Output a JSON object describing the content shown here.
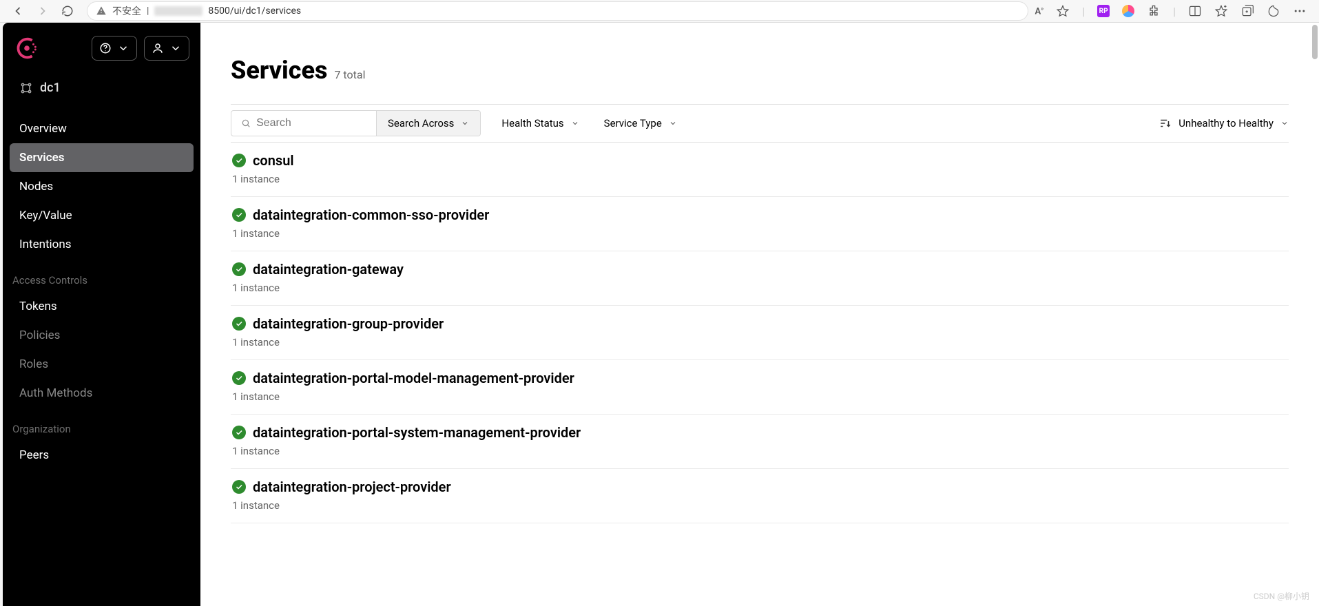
{
  "browser": {
    "not_secure_label": "不安全",
    "url_suffix": "8500/ui/dc1/services"
  },
  "sidebar": {
    "datacenter": "dc1",
    "main_nav": [
      {
        "label": "Overview"
      },
      {
        "label": "Services"
      },
      {
        "label": "Nodes"
      },
      {
        "label": "Key/Value"
      },
      {
        "label": "Intentions"
      }
    ],
    "active_index": 1,
    "section_access_label": "Access Controls",
    "access_nav": [
      {
        "label": "Tokens"
      },
      {
        "label": "Policies"
      },
      {
        "label": "Roles"
      },
      {
        "label": "Auth Methods"
      }
    ],
    "section_org_label": "Organization",
    "org_nav": [
      {
        "label": "Peers"
      }
    ]
  },
  "page": {
    "title": "Services",
    "total_text": "7 total"
  },
  "toolbar": {
    "search_placeholder": "Search",
    "search_across_label": "Search Across",
    "health_status_label": "Health Status",
    "service_type_label": "Service Type",
    "sort_label": "Unhealthy to Healthy"
  },
  "services": [
    {
      "name": "consul",
      "instances_text": "1 instance"
    },
    {
      "name": "dataintegration-common-sso-provider",
      "instances_text": "1 instance"
    },
    {
      "name": "dataintegration-gateway",
      "instances_text": "1 instance"
    },
    {
      "name": "dataintegration-group-provider",
      "instances_text": "1 instance"
    },
    {
      "name": "dataintegration-portal-model-management-provider",
      "instances_text": "1 instance"
    },
    {
      "name": "dataintegration-portal-system-management-provider",
      "instances_text": "1 instance"
    },
    {
      "name": "dataintegration-project-provider",
      "instances_text": "1 instance"
    }
  ],
  "watermark": "CSDN @柳小钥"
}
